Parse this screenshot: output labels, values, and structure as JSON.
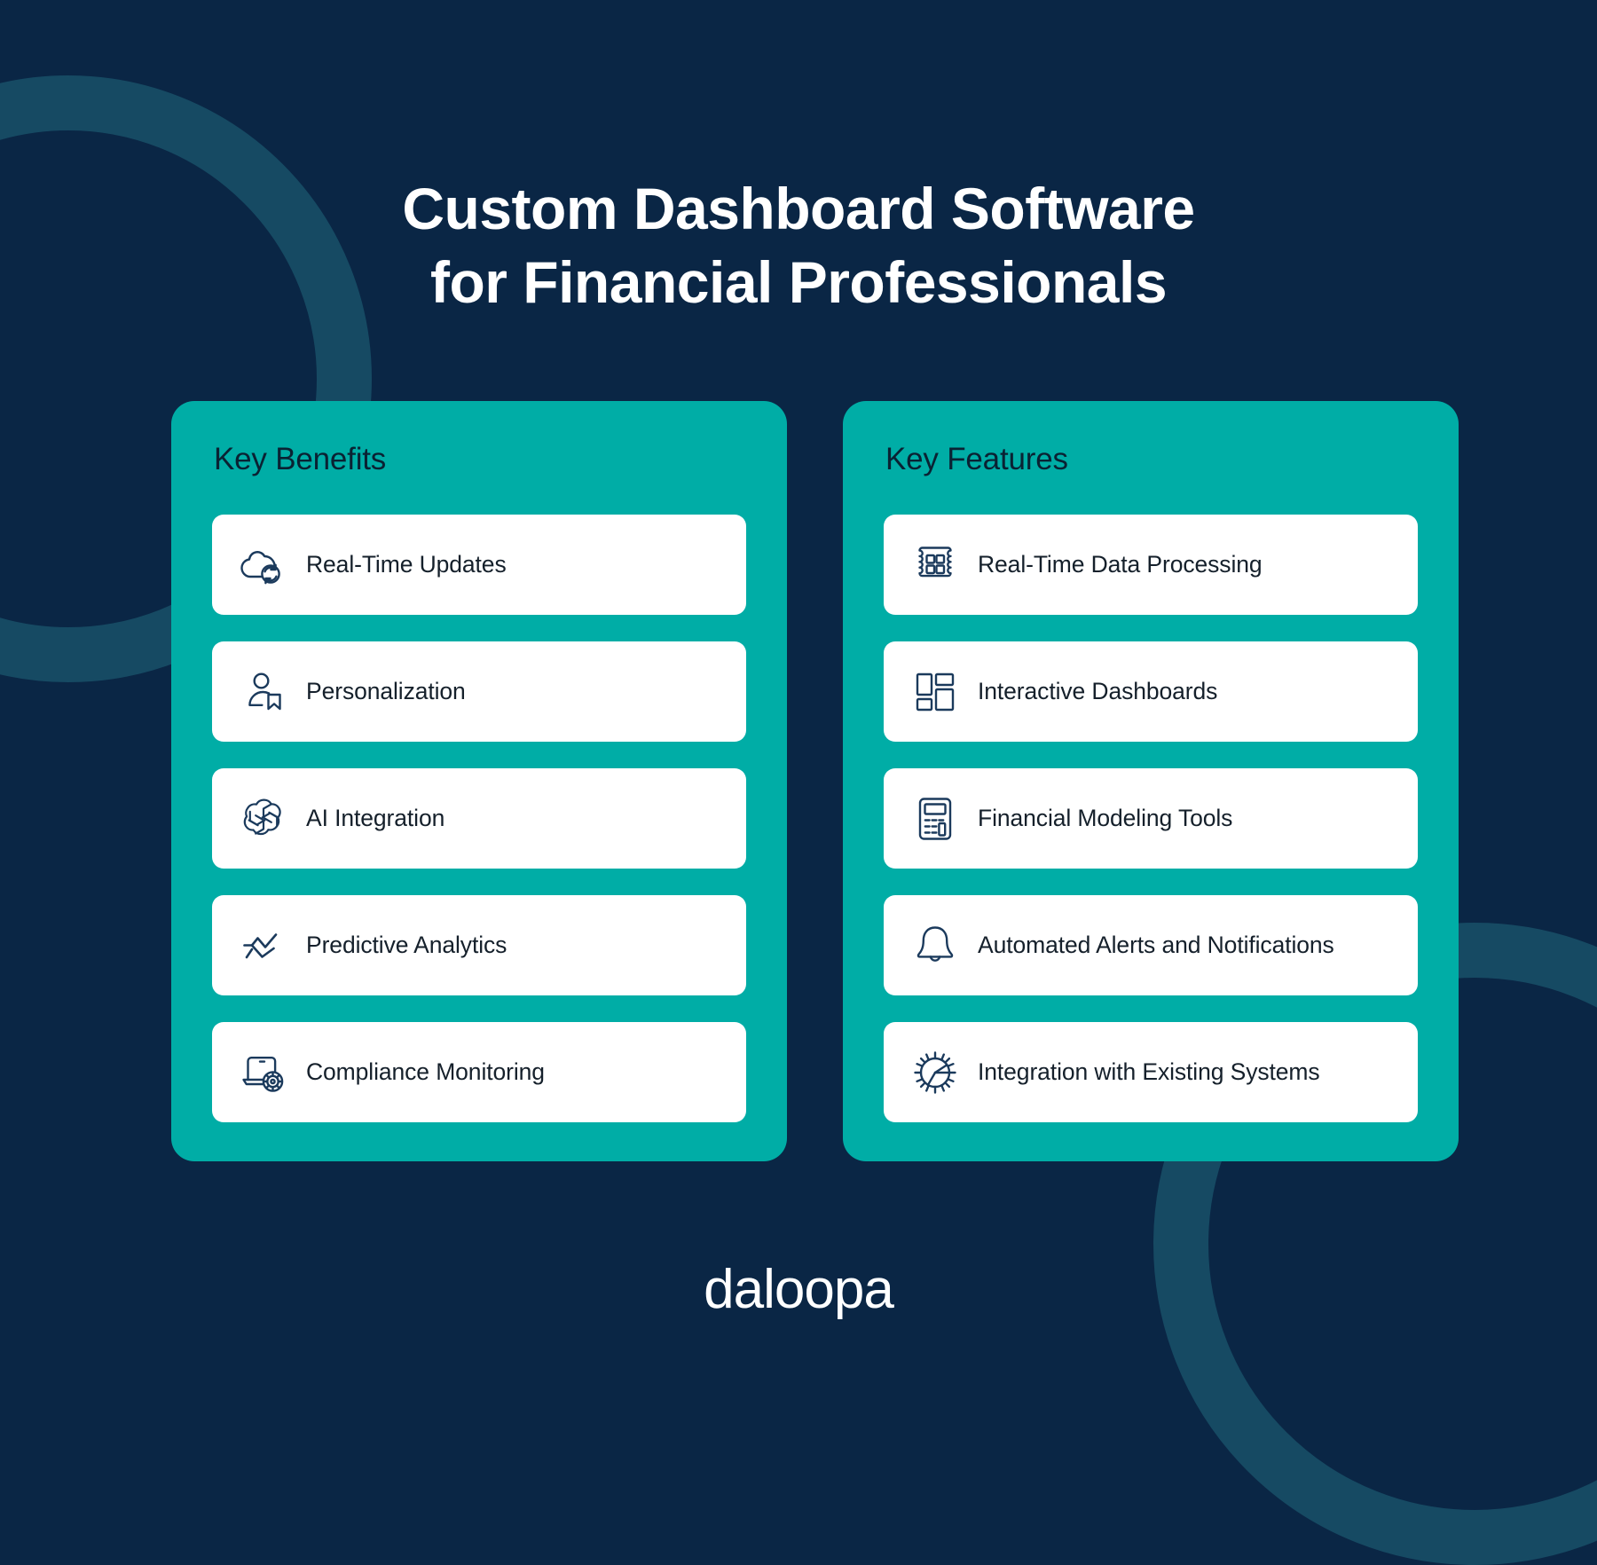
{
  "colors": {
    "background_navy": "#0a2645",
    "ring_navy": "#164a63",
    "panel_teal": "#00ada6",
    "card_white": "#ffffff",
    "icon_stroke": "#1b3a5c",
    "heading_dark": "#0a2233",
    "label_dark": "#15202b",
    "title_white": "#ffffff"
  },
  "headline": {
    "line1": "Custom Dashboard Software",
    "line2": "for Financial Professionals"
  },
  "panels": [
    {
      "title": "Key Benefits",
      "items": [
        {
          "label": "Real-Time Updates",
          "icon": "cloud-sync-icon"
        },
        {
          "label": "Personalization",
          "icon": "person-bookmark-icon"
        },
        {
          "label": "AI Integration",
          "icon": "openai-knot-icon"
        },
        {
          "label": "Predictive Analytics",
          "icon": "trend-line-icon"
        },
        {
          "label": "Compliance Monitoring",
          "icon": "laptop-gear-icon"
        }
      ]
    },
    {
      "title": "Key Features",
      "items": [
        {
          "label": "Real-Time Data Processing",
          "icon": "processor-chip-icon"
        },
        {
          "label": "Interactive Dashboards",
          "icon": "dashboard-layout-icon"
        },
        {
          "label": "Financial Modeling Tools",
          "icon": "calculator-icon"
        },
        {
          "label": "Automated Alerts and Notifications",
          "icon": "bell-icon"
        },
        {
          "label": "Integration with Existing Systems",
          "icon": "hub-gear-icon"
        }
      ]
    }
  ],
  "footer": {
    "logo_text": "daloopa"
  }
}
